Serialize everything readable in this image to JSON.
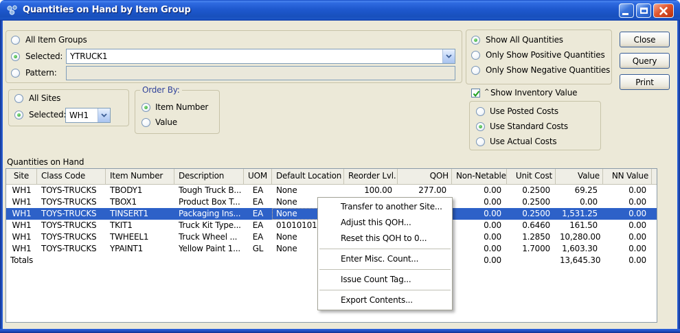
{
  "window": {
    "title": "Quantities on Hand by Item Group"
  },
  "colors": {
    "titlebar_blue": "#1E55C8",
    "dialog_background": "#ECE9D8",
    "selection_blue": "#2D61C8",
    "radio_dot_green": "#2DA12D"
  },
  "filters": {
    "item_group": {
      "all_label": "All Item Groups",
      "selected_label": "Selected:",
      "selected_value": "YTRUCK1",
      "pattern_label": "Pattern:",
      "pattern_value": ""
    },
    "sites": {
      "all_label": "All Sites",
      "selected_label": "Selected:",
      "selected_value": "WH1"
    },
    "order_by": {
      "title": "Order By:",
      "options": [
        {
          "label": "Item Number",
          "selected": true
        },
        {
          "label": "Value",
          "selected": false
        }
      ]
    },
    "quantities": {
      "options": [
        {
          "label": "Show All Quantities",
          "selected": true
        },
        {
          "label": "Only Show Positive Quantities",
          "selected": false
        },
        {
          "label": "Only Show Negative Quantities",
          "selected": false
        }
      ]
    },
    "inventory_value": {
      "prefix": "^",
      "label": "Show Inventory Value",
      "checked": true
    },
    "costs": {
      "options": [
        {
          "label": "Use Posted Costs",
          "selected": false
        },
        {
          "label": "Use Standard Costs",
          "selected": true
        },
        {
          "label": "Use Actual Costs",
          "selected": false
        }
      ]
    }
  },
  "buttons": {
    "close": "Close",
    "query": "Query",
    "print": "Print"
  },
  "table": {
    "caption": "Quantities on Hand",
    "columns": [
      "Site",
      "Class Code",
      "Item Number",
      "Description",
      "UOM",
      "Default Location",
      "Reorder Lvl.",
      "QOH",
      "Non-Netable",
      "Unit Cost",
      "Value",
      "NN Value"
    ],
    "selected_row_index": 2,
    "rows": [
      {
        "cells": [
          "WH1",
          "TOYS-TRUCKS",
          "TBODY1",
          "Tough Truck B...",
          "EA",
          "None",
          "100.00",
          "277.00",
          "0.00",
          "0.2500",
          "69.25",
          "0.00"
        ],
        "selected": false,
        "totals": false
      },
      {
        "cells": [
          "WH1",
          "TOYS-TRUCKS",
          "TBOX1",
          "Product Box T...",
          "EA",
          "None",
          "",
          "",
          "0.00",
          "0.2500",
          "0.00",
          "0.00"
        ],
        "selected": false,
        "totals": false
      },
      {
        "cells": [
          "WH1",
          "TOYS-TRUCKS",
          "TINSERT1",
          "Packaging Ins...",
          "EA",
          "None",
          "",
          "",
          "0.00",
          "0.2500",
          "1,531.25",
          "0.00"
        ],
        "selected": true,
        "focus_cell": 5,
        "totals": false
      },
      {
        "cells": [
          "WH1",
          "TOYS-TRUCKS",
          "TKIT1",
          "Truck Kit Type...",
          "EA",
          "01010101",
          "",
          "",
          "0.00",
          "0.6460",
          "161.50",
          "0.00"
        ],
        "selected": false,
        "totals": false
      },
      {
        "cells": [
          "WH1",
          "TOYS-TRUCKS",
          "TWHEEL1",
          "Truck Wheel ...",
          "EA",
          "None",
          "",
          "",
          "0.00",
          "1.2850",
          "10,280.00",
          "0.00"
        ],
        "selected": false,
        "totals": false
      },
      {
        "cells": [
          "WH1",
          "TOYS-TRUCKS",
          "YPAINT1",
          "Yellow Paint 1...",
          "GL",
          "None",
          "",
          "",
          "0.00",
          "1.7000",
          "1,603.30",
          "0.00"
        ],
        "selected": false,
        "totals": false
      },
      {
        "cells": [
          "Totals",
          "",
          "",
          "",
          "",
          "",
          "",
          "",
          "0.00",
          "",
          "13,645.30",
          "0.00"
        ],
        "selected": false,
        "totals": true
      }
    ]
  },
  "context_menu": {
    "items": [
      {
        "name": "transfer-to-another-site",
        "label": "Transfer to another Site...",
        "separator_after": false
      },
      {
        "name": "adjust-this-qoh",
        "label": "Adjust this QOH...",
        "separator_after": false
      },
      {
        "name": "reset-this-qoh-to-0",
        "label": "Reset this QOH to 0...",
        "separator_after": true
      },
      {
        "name": "enter-misc-count",
        "label": "Enter Misc. Count...",
        "separator_after": true
      },
      {
        "name": "issue-count-tag",
        "label": "Issue Count Tag...",
        "separator_after": true
      },
      {
        "name": "export-contents",
        "label": "Export Contents...",
        "separator_after": false
      }
    ]
  }
}
